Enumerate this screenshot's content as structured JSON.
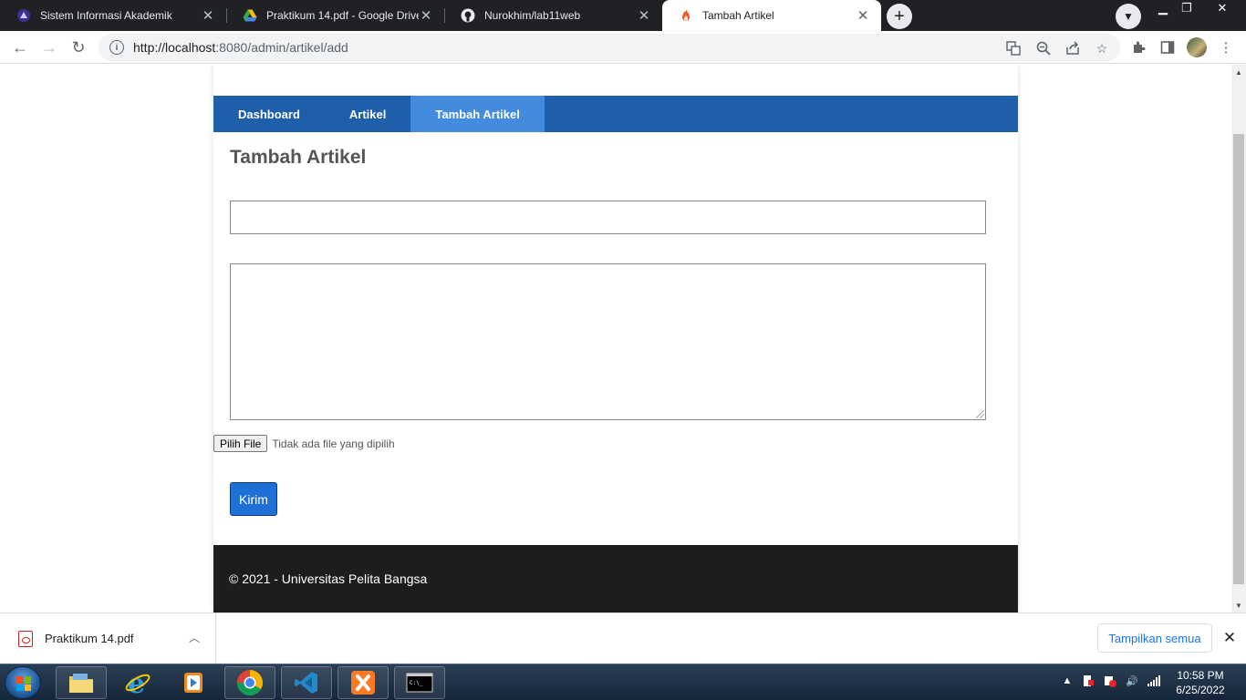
{
  "browser": {
    "tabs": [
      {
        "title": "Sistem Informasi Akademik",
        "favicon": "university-icon",
        "active": false
      },
      {
        "title": "Praktikum 14.pdf - Google Drive",
        "favicon": "google-drive-icon",
        "active": false
      },
      {
        "title": "Nurokhim/lab11web",
        "favicon": "github-icon",
        "active": false
      },
      {
        "title": "Tambah Artikel",
        "favicon": "flame-icon",
        "active": true
      }
    ],
    "url_host": "http://localhost",
    "url_path": ":8080/admin/artikel/add"
  },
  "page": {
    "nav": {
      "items": [
        {
          "label": "Dashboard",
          "active": false
        },
        {
          "label": "Artikel",
          "active": false
        },
        {
          "label": "Tambah Artikel",
          "active": true
        }
      ]
    },
    "title": "Tambah Artikel",
    "form": {
      "judul_value": "",
      "isi_value": "",
      "file_button": "Pilih File",
      "file_status": "Tidak ada file yang dipilih",
      "submit_label": "Kirim"
    },
    "footer_text": "© 2021 - Universitas Pelita Bangsa"
  },
  "downloads": {
    "file_name": "Praktikum 14.pdf",
    "show_all": "Tampilkan semua"
  },
  "taskbar": {
    "time": "10:58 PM",
    "date": "6/25/2022"
  },
  "colors": {
    "nav_bg": "#1f5faa",
    "nav_active": "#428bdf",
    "submit": "#1f70d6",
    "footer": "#1d1d1d"
  }
}
